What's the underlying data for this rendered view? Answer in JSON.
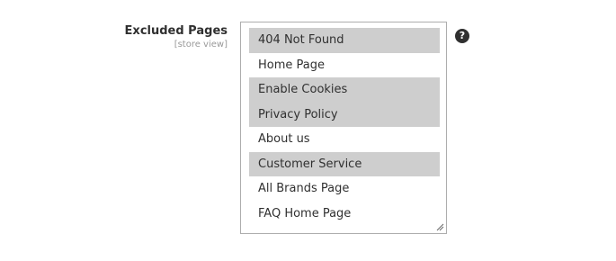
{
  "field": {
    "label": "Excluded Pages",
    "scope": "[store view]",
    "help_icon": "question-circle-icon",
    "help_glyph": "?"
  },
  "options": [
    {
      "label": "404 Not Found",
      "selected": true
    },
    {
      "label": "Home Page",
      "selected": false
    },
    {
      "label": "Enable Cookies",
      "selected": true
    },
    {
      "label": "Privacy Policy",
      "selected": true
    },
    {
      "label": "About us",
      "selected": false
    },
    {
      "label": "Customer Service",
      "selected": true
    },
    {
      "label": "All Brands Page",
      "selected": false
    },
    {
      "label": "FAQ Home Page",
      "selected": false
    }
  ],
  "colors": {
    "selected_bg": "#cecece",
    "text": "#303030",
    "scope_text": "#999999",
    "border": "#adadad"
  }
}
